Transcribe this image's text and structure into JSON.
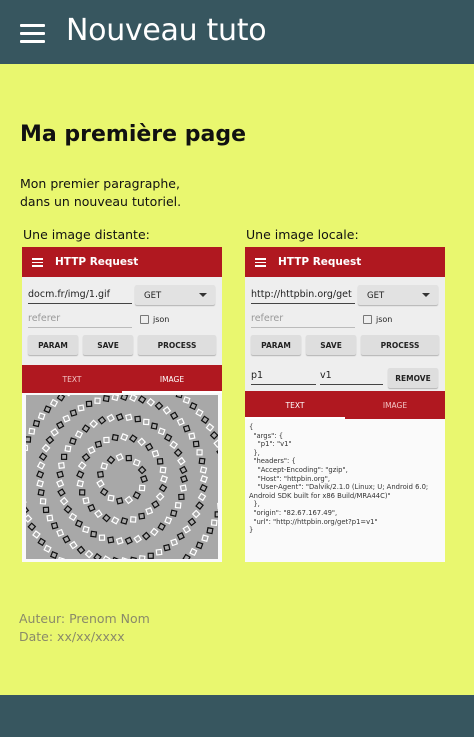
{
  "header": {
    "title": "Nouveau tuto"
  },
  "page": {
    "title": "Ma première page",
    "paragraph": [
      "Mon premier paragraphe,",
      "dans un nouveau tutoriel."
    ]
  },
  "captions": {
    "remote": "Une image distante:",
    "local": "Une image locale:"
  },
  "phone_left": {
    "app_title": "HTTP Request",
    "url": "docm.fr/img/1.gif",
    "method": "GET",
    "referer_placeholder": "referer",
    "json_label": "json",
    "buttons": [
      "PARAM",
      "SAVE",
      "PROCESS"
    ],
    "tabs": [
      "TEXT",
      "IMAGE"
    ],
    "active_tab": "IMAGE"
  },
  "phone_right": {
    "app_title": "HTTP Request",
    "url": "http://httpbin.org/get",
    "method": "GET",
    "referer_placeholder": "referer",
    "json_label": "json",
    "buttons": [
      "PARAM",
      "SAVE",
      "PROCESS"
    ],
    "param_key": "p1",
    "param_value": "v1",
    "remove_label": "REMOVE",
    "tabs": [
      "TEXT",
      "IMAGE"
    ],
    "active_tab": "TEXT",
    "response_text": "{\n  \"args\": {\n    \"p1\": \"v1\"\n  },\n  \"headers\": {\n    \"Accept-Encoding\": \"gzip\",\n    \"Host\": \"httpbin.org\",\n    \"User-Agent\": \"Dalvik/2.1.0 (Linux; U; Android 6.0;\nAndroid SDK built for x86 Build/MRA44C)\"\n  },\n  \"origin\": \"82.67.167.49\",\n  \"url\": \"http://httpbin.org/get?p1=v1\"\n}"
  },
  "footer": {
    "author": "Auteur: Prenom Nom",
    "date": "Date: xx/xx/xxxx"
  },
  "colors": {
    "topbar": "#37565f",
    "background": "#e9f76f",
    "accent": "#b01820"
  }
}
